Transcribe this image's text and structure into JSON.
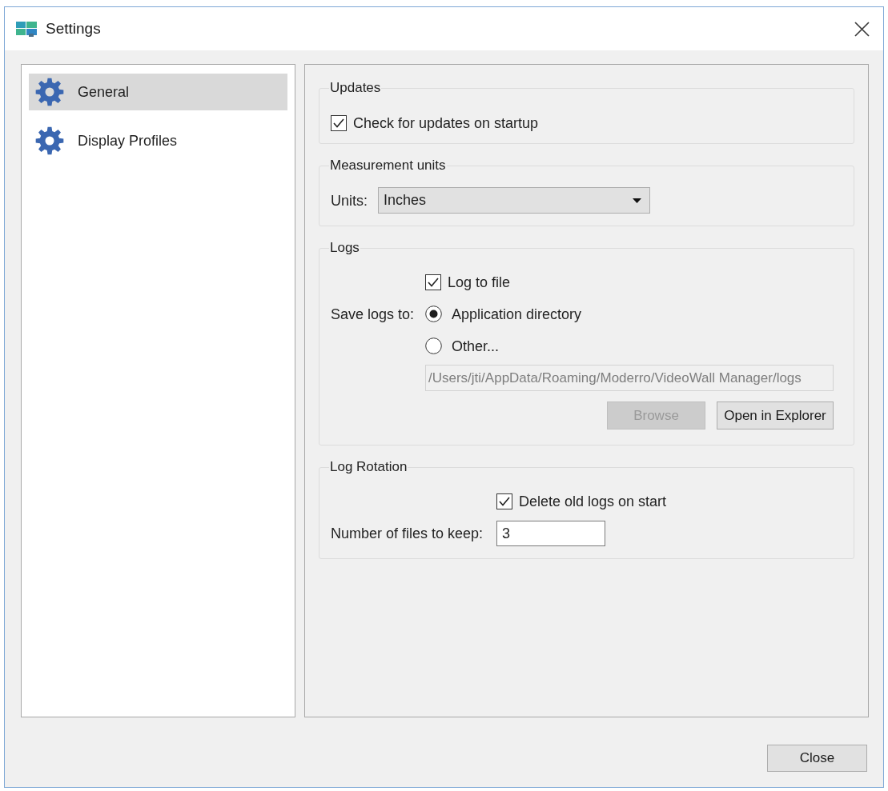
{
  "window": {
    "title": "Settings"
  },
  "sidebar": {
    "items": [
      {
        "label": "General",
        "selected": true
      },
      {
        "label": "Display Profiles",
        "selected": false
      }
    ]
  },
  "updates": {
    "title": "Updates",
    "check_on_startup": {
      "label": "Check for updates on startup",
      "checked": true
    }
  },
  "measurement_units": {
    "title": "Measurement units",
    "units": {
      "label": "Units:",
      "value": "Inches"
    }
  },
  "logs": {
    "title": "Logs",
    "log_to_file": {
      "label": "Log to file",
      "checked": true
    },
    "save_label": "Save logs to:",
    "locations": [
      {
        "label": "Application directory",
        "selected": true
      },
      {
        "label": "Other...",
        "selected": false
      }
    ],
    "path": {
      "value": "/Users/jti/AppData/Roaming/Moderro/VideoWall Manager/logs",
      "disabled": true
    },
    "buttons": [
      {
        "label": "Browse",
        "disabled": true
      },
      {
        "label": "Open in Explorer",
        "disabled": false
      }
    ]
  },
  "log_rotation": {
    "title": "Log Rotation",
    "delete_old": {
      "label": "Delete old logs on start",
      "checked": true
    },
    "files_to_keep": {
      "label": "Number of files to keep:",
      "value": "3"
    }
  },
  "footer": {
    "buttons": [
      {
        "label": "Close"
      }
    ]
  }
}
